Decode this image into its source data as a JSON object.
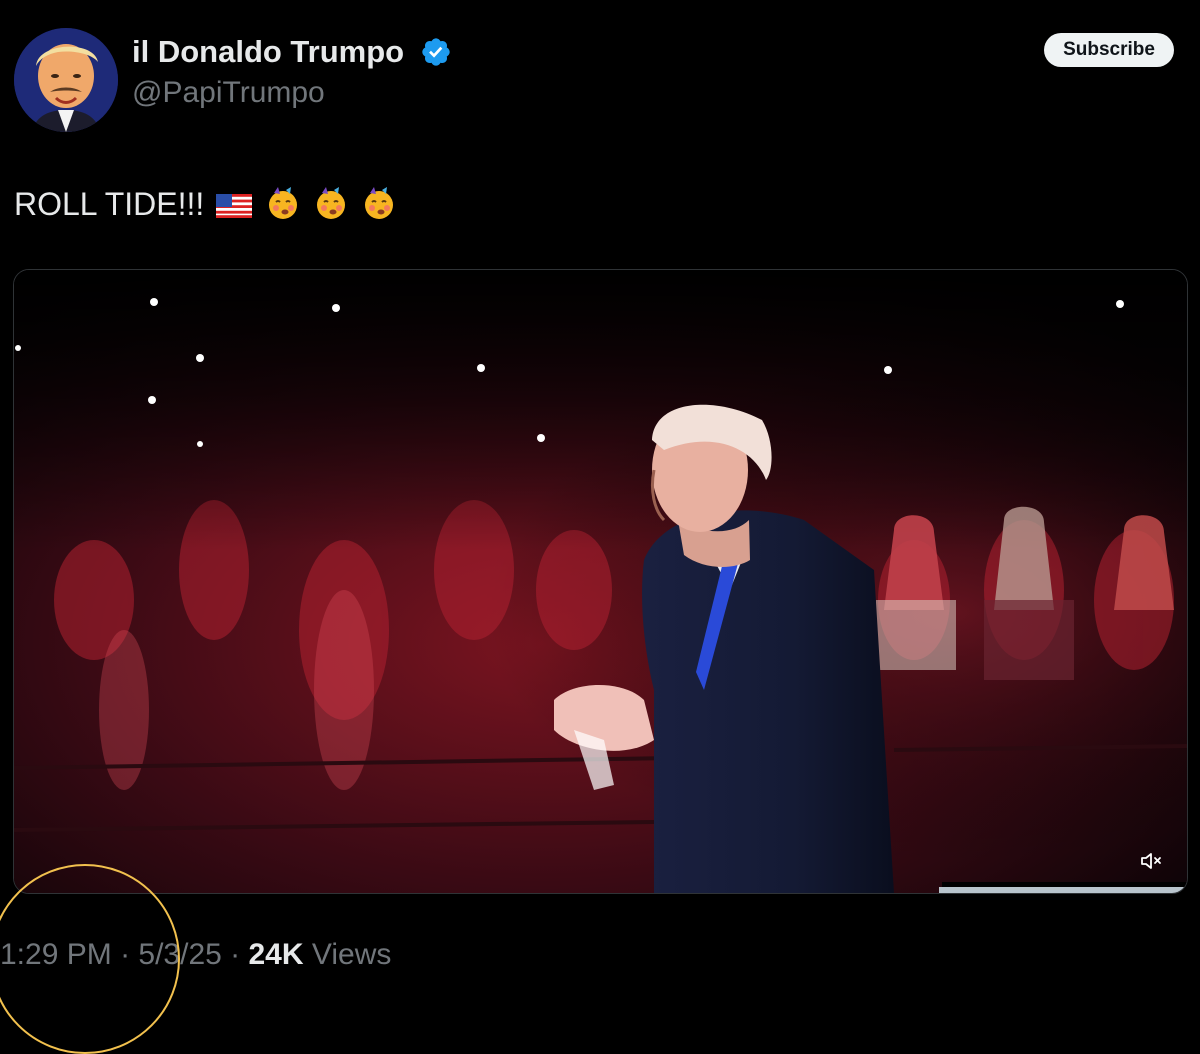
{
  "post": {
    "author": {
      "display_name": "il Donaldo Trumpo",
      "handle": "@PapiTrumpo",
      "verified_badge_icon": "verified-checkmark-icon",
      "badge_color": "#1d9bf0"
    },
    "subscribe_label": "Subscribe",
    "text": "ROLL TIDE!!!",
    "emojis": [
      "flag-us-icon",
      "face-savoring-icon",
      "face-savoring-icon",
      "face-savoring-icon"
    ],
    "media": {
      "type": "video",
      "description_icon": "video-player",
      "mute_icon": "speaker-muted-icon"
    },
    "meta": {
      "time": "1:29 PM",
      "separator": " · ",
      "date": "5/3/25",
      "views_count": "24K",
      "views_label": " Views"
    }
  },
  "colors": {
    "background": "#000000",
    "text_primary": "#e7e9ea",
    "text_secondary": "#71767b",
    "highlight_circle": "#f2c14e"
  }
}
